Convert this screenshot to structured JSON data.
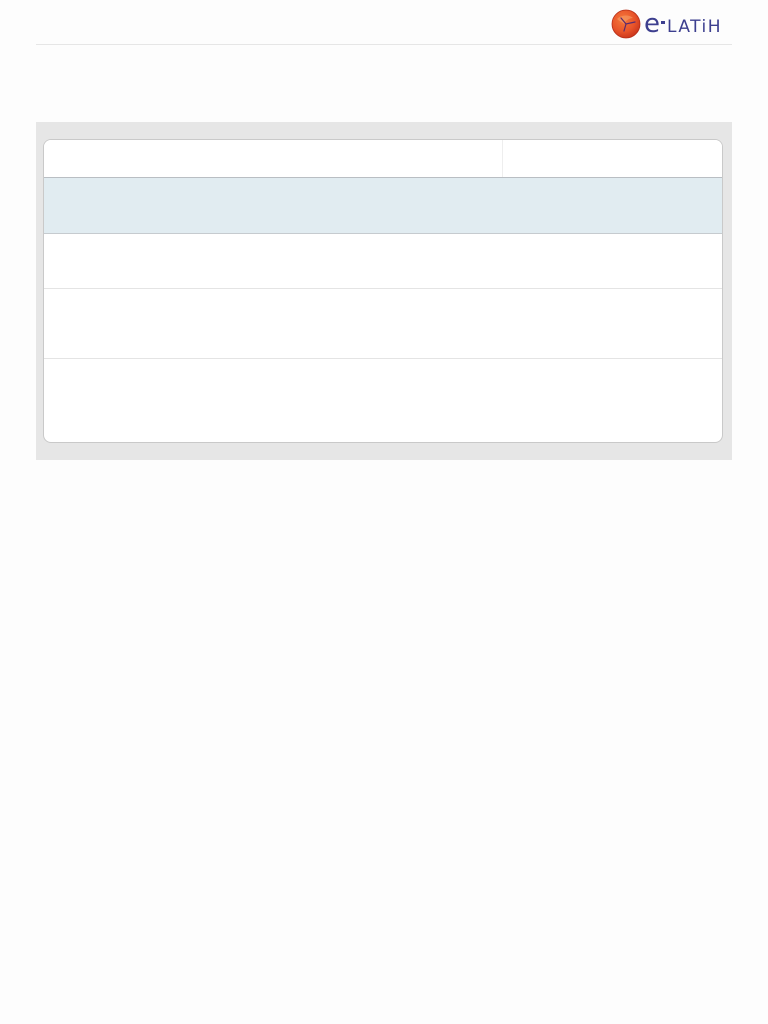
{
  "header": {
    "logo": {
      "brand_text": "e-LATiH",
      "mark_icon": "e-latih-logo-mark-icon",
      "colors": {
        "mark_orange": "#e8542a",
        "mark_red": "#d53a1c",
        "text_navy": "#3d3f8f"
      }
    }
  },
  "table": {
    "columns": [
      "",
      ""
    ],
    "rows": [
      {
        "cells": [
          "",
          ""
        ],
        "highlighted": true
      },
      {
        "cells": [
          "",
          ""
        ],
        "highlighted": false
      },
      {
        "cells": [
          "",
          ""
        ],
        "highlighted": false
      },
      {
        "cells": [
          "",
          ""
        ],
        "highlighted": false
      }
    ],
    "colors": {
      "panel_background": "#e6e6e6",
      "highlight_row": "#e1ecf1",
      "border": "#c9c9c9"
    }
  }
}
